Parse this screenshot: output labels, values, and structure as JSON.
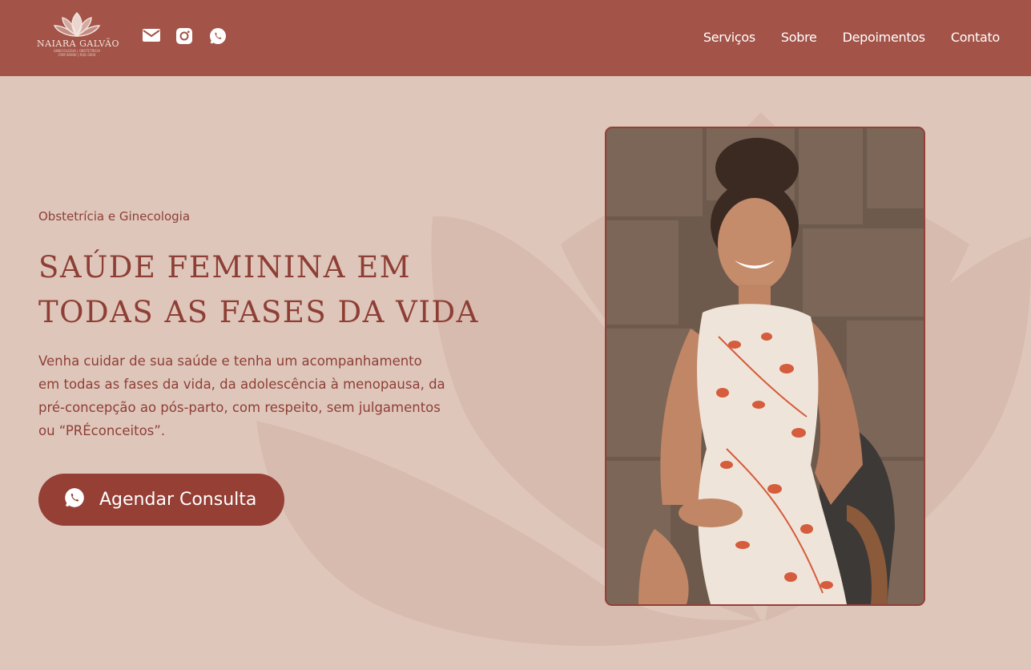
{
  "brand": {
    "name": "NAIARA GALVÃO",
    "tagline": "GINECOLOGIA | OBSTETRÍCIA",
    "tagline2": "CRM 00000 | RQE 0000"
  },
  "social": {
    "icons": [
      "mail-icon",
      "instagram-icon",
      "whatsapp-icon"
    ]
  },
  "nav": {
    "items": [
      "Serviços",
      "Sobre",
      "Depoimentos",
      "Contato"
    ]
  },
  "hero": {
    "eyebrow": "Obstetrícia e Ginecologia",
    "title_line1": "SAÚDE FEMININA EM",
    "title_line2": "TODAS AS FASES DA VIDA",
    "lead": "Venha cuidar de sua saúde e tenha um acompanhamento em todas as fases da vida, da adolescência à menopausa, da pré-concepção ao pós-parto, com respeito, sem julgamentos ou “PRÉconceitos”.",
    "cta_label": "Agendar Consulta",
    "cta_icon": "whatsapp-icon"
  },
  "colors": {
    "header_bg": "#a35347",
    "page_bg": "#dfc6bb",
    "accent": "#953f35",
    "text": "#8e3f35"
  }
}
